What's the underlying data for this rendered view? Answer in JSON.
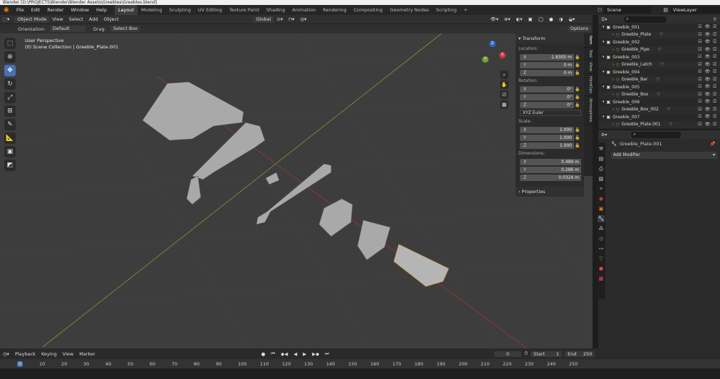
{
  "titlebar": "Blender [D:\\PROJECTS\\Blender\\Blender Assets\\Greebles\\Greebles.blend]",
  "menu": [
    "File",
    "Edit",
    "Render",
    "Window",
    "Help"
  ],
  "workspaces": [
    "Layout",
    "Modeling",
    "Sculpting",
    "UV Editing",
    "Texture Paint",
    "Shading",
    "Animation",
    "Rendering",
    "Compositing",
    "Geometry Nodes",
    "Scripting",
    "+"
  ],
  "active_workspace": "Layout",
  "scene": "Scene",
  "view_layer": "ViewLayer",
  "header": {
    "mode": "Object Mode",
    "view": "View",
    "select": "Select",
    "add": "Add",
    "object": "Object",
    "transform_orientation": "Global"
  },
  "toolsettings": {
    "orientation_label": "Orientation:",
    "orientation_value": "Default",
    "drag_label": "Drag:",
    "drag_value": "Select Box",
    "options": "Options"
  },
  "viewport": {
    "perspective": "User Perspective",
    "collection": "(0) Scene Collection | Greeble_Plate.001"
  },
  "gizmo": {
    "x": "X",
    "y": "Y",
    "z": "Z"
  },
  "npanel": {
    "transform_title": "Transform",
    "location_label": "Location:",
    "location": [
      {
        "axis": "X",
        "value": "-1.8305 m"
      },
      {
        "axis": "Y",
        "value": "0 m"
      },
      {
        "axis": "Z",
        "value": "0 m"
      }
    ],
    "rotation_label": "Rotation:",
    "rotation": [
      {
        "axis": "X",
        "value": "0°"
      },
      {
        "axis": "Y",
        "value": "0°"
      },
      {
        "axis": "Z",
        "value": "0°"
      }
    ],
    "rotation_mode": "XYZ Euler",
    "scale_label": "Scale:",
    "scale": [
      {
        "axis": "X",
        "value": "1.000"
      },
      {
        "axis": "Y",
        "value": "1.000"
      },
      {
        "axis": "Z",
        "value": "1.000"
      }
    ],
    "dimensions_label": "Dimensions:",
    "dimensions": [
      {
        "axis": "X",
        "value": "0.489 m"
      },
      {
        "axis": "Y",
        "value": "0.286 m"
      },
      {
        "axis": "Z",
        "value": "0.0324 m"
      }
    ],
    "properties_title": "Properties",
    "tabs": [
      "Item",
      "Tool",
      "View",
      "HardOps",
      "Atmosphere"
    ]
  },
  "outliner": {
    "rows": [
      {
        "name": "Greeble_001",
        "level": 0
      },
      {
        "name": "Greeble_Plate",
        "level": 1
      },
      {
        "name": "Greeble_002",
        "level": 0
      },
      {
        "name": "Greeble_Pipe",
        "level": 1
      },
      {
        "name": "Greeble_003",
        "level": 0
      },
      {
        "name": "Greeble_Latch",
        "level": 1
      },
      {
        "name": "Greeble_004",
        "level": 0
      },
      {
        "name": "Greeble_Bar",
        "level": 1
      },
      {
        "name": "Greeble_005",
        "level": 0
      },
      {
        "name": "Greeble_Box",
        "level": 1
      },
      {
        "name": "Greeble_006",
        "level": 0
      },
      {
        "name": "Greeble_Box_002",
        "level": 1
      },
      {
        "name": "Greeble_007",
        "level": 0
      },
      {
        "name": "Greeble_Plate.001",
        "level": 1
      }
    ]
  },
  "properties": {
    "object_name": "Greeble_Plate.001",
    "add_modifier": "Add Modifier"
  },
  "timeline": {
    "playback": "Playback",
    "keying": "Keying",
    "view": "View",
    "marker": "Marker",
    "current_frame": "0",
    "start_label": "Start",
    "start": "1",
    "end_label": "End",
    "end": "250",
    "ticks": [
      "0",
      "10",
      "20",
      "30",
      "40",
      "50",
      "60",
      "70",
      "80",
      "90",
      "100",
      "110",
      "120",
      "130",
      "140",
      "150",
      "160",
      "170",
      "180",
      "190",
      "200",
      "210",
      "220",
      "230",
      "240",
      "250"
    ]
  },
  "colors": {
    "accent": "#4772b3",
    "x_axis": "#c03a3a",
    "y_axis": "#8bab3a",
    "viewport_bg": "#3d3d3d"
  }
}
